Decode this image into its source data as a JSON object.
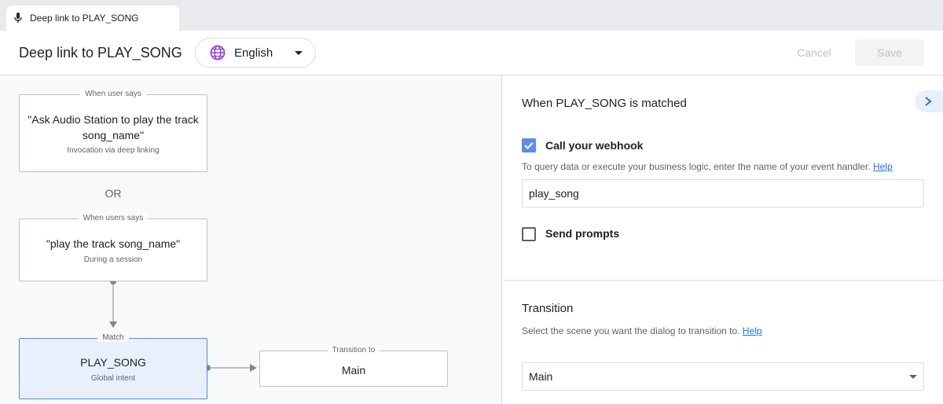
{
  "tab": {
    "title": "Deep link to PLAY_SONG",
    "icon": "microphone-icon"
  },
  "header": {
    "title": "Deep link to PLAY_SONG",
    "language": "English",
    "cancel_label": "Cancel",
    "save_label": "Save"
  },
  "canvas": {
    "nodes": [
      {
        "caption": "When user says",
        "text": "\"Ask Audio Station to play the track song_name\"",
        "sub": "Invocation via deep linking"
      },
      {
        "caption": "When users says",
        "text": "\"play the track song_name\"",
        "sub": "During a session"
      },
      {
        "caption": "Match",
        "text": "PLAY_SONG",
        "sub": "Global intent"
      },
      {
        "caption": "Transition to",
        "text": "Main"
      }
    ],
    "or_label": "OR"
  },
  "panel": {
    "heading": "When PLAY_SONG is matched",
    "webhook": {
      "label": "Call your webhook",
      "checked": true,
      "hint": "To query data or execute your business logic, enter the name of your event handler.",
      "help": "Help",
      "value": "play_song"
    },
    "prompts": {
      "label": "Send prompts",
      "checked": false
    },
    "transition": {
      "heading": "Transition",
      "hint": "Select the scene you want the dialog to transition to.",
      "help": "Help",
      "value": "Main"
    }
  },
  "colors": {
    "accent": "#1a73e8",
    "match_node_bg": "#e8f0fe",
    "checkbox": "#5b8def"
  }
}
